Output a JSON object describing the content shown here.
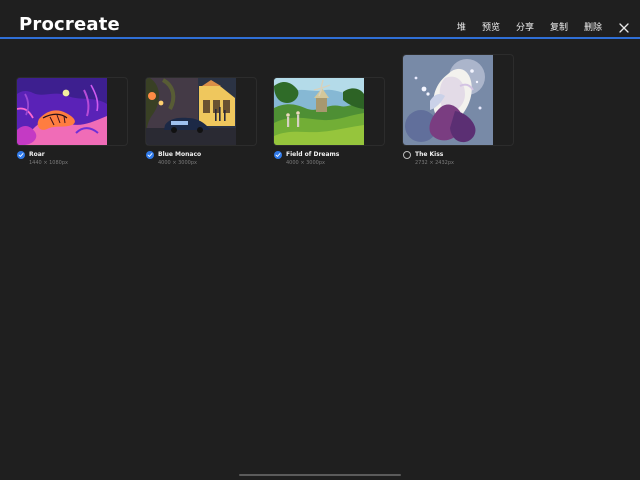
{
  "header": {
    "title": "Procreate",
    "actions": [
      {
        "label": "堆"
      },
      {
        "label": "预览"
      },
      {
        "label": "分享"
      },
      {
        "label": "复制"
      },
      {
        "label": "删除"
      }
    ],
    "close_icon": "close-icon"
  },
  "artworks": [
    {
      "name": "Roar",
      "size": "1440 × 1080px",
      "selected": true
    },
    {
      "name": "Blue Monaco",
      "size": "4000 × 3000px",
      "selected": true
    },
    {
      "name": "Field of Dreams",
      "size": "4000 × 3000px",
      "selected": true
    },
    {
      "name": "The Kiss",
      "size": "2732 × 2432px",
      "selected": false
    }
  ],
  "colors": {
    "background": "#1f1f1f",
    "accent": "#2f79e8",
    "header_line": "#2f6fd6"
  }
}
